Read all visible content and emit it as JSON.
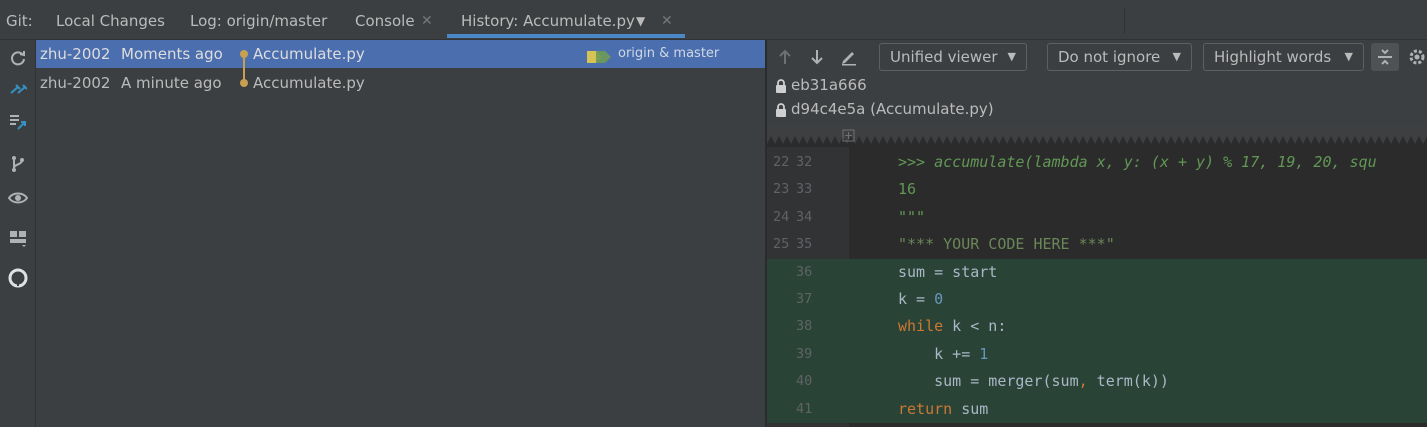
{
  "topbar": {
    "git_label": "Git:",
    "tabs": [
      {
        "label": "Local Changes"
      },
      {
        "label": "Log: origin/master"
      },
      {
        "label": "Console"
      },
      {
        "label": "History: Accumulate.py"
      }
    ]
  },
  "sidebar": {
    "icons": [
      "refresh-icon",
      "compare-icon",
      "compare-list-icon",
      "branch-icon",
      "eye-icon",
      "layout-icon",
      "github-icon"
    ]
  },
  "history": {
    "rows": [
      {
        "author": "zhu-2002",
        "time": "Moments ago",
        "file": "Accumulate.py",
        "tag": "origin & master",
        "selected": true
      },
      {
        "author": "zhu-2002",
        "time": "A minute ago",
        "file": "Accumulate.py",
        "tag": "",
        "selected": false
      }
    ]
  },
  "diff": {
    "viewer": "Unified viewer",
    "ignore": "Do not ignore",
    "highlight": "Highlight words",
    "revisions": [
      "eb31a666",
      "d94c4e5a (Accumulate.py)"
    ],
    "lines": [
      {
        "old": "22",
        "new": "32",
        "text": ">>> accumulate(lambda x, y: (x + y) % 17, 19, 20, squ",
        "added": false
      },
      {
        "old": "23",
        "new": "33",
        "text": "16",
        "added": false
      },
      {
        "old": "24",
        "new": "34",
        "text": "\"\"\"",
        "added": false
      },
      {
        "old": "25",
        "new": "35",
        "text": "\"*** YOUR CODE HERE ***\"",
        "added": false
      },
      {
        "old": "",
        "new": "36",
        "text": "sum = start",
        "added": true
      },
      {
        "old": "",
        "new": "37",
        "text": "k = 0",
        "added": true
      },
      {
        "old": "",
        "new": "38",
        "text": "while k < n:",
        "added": true
      },
      {
        "old": "",
        "new": "39",
        "text": "    k += 1",
        "added": true
      },
      {
        "old": "",
        "new": "40",
        "text": "    sum = merger(sum, term(k))",
        "added": true
      },
      {
        "old": "",
        "new": "41",
        "text": "return sum",
        "added": true
      }
    ]
  },
  "colors": {
    "selection": "#4b6eaf",
    "added_line": "#294436",
    "tab_underline": "#4a88c7",
    "graph": "#c8a050"
  }
}
